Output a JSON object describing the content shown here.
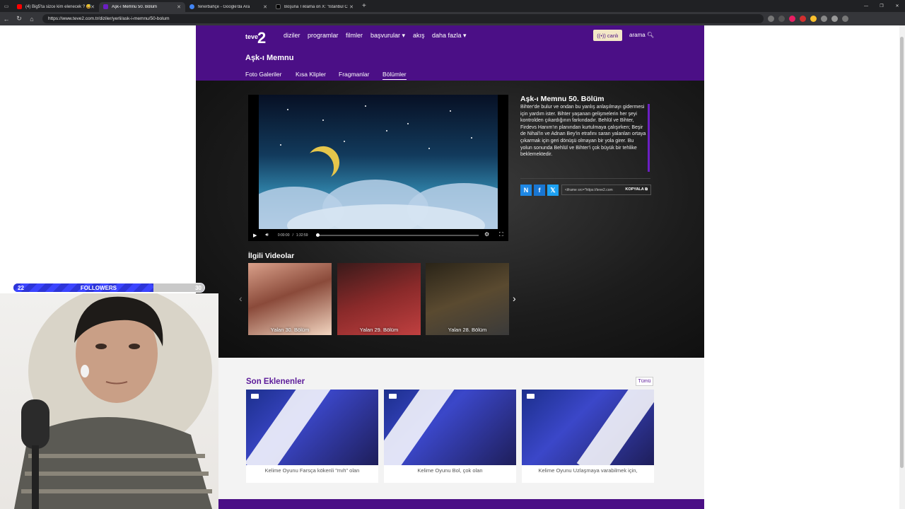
{
  "browser": {
    "tabs": [
      {
        "title": "(4) Big5'ta sizce kim elenecek ? 😅",
        "color": "#ff0000"
      },
      {
        "title": "Aşk-ı Memnu 50. Bölüm",
        "color": "#6b1fc3"
      },
      {
        "title": "fenerbahçe - Google'da Ara",
        "color": "#4285f4"
      },
      {
        "title": "Boşuna Tıklama on X: \"İstanbul C",
        "color": "#000000"
      }
    ],
    "new_tab": "+",
    "url": "https://www.teve2.com.tr/diziler/yerli/ask-i-memnu/50-bolum"
  },
  "site": {
    "logo": "teve2",
    "nav": [
      "diziler",
      "programlar",
      "filmler",
      "başvurular ▾",
      "akış",
      "daha fazla ▾"
    ],
    "live": "((•)) canlı",
    "search": "arama",
    "show_title": "Aşk-ı Memnu",
    "subtabs": [
      "Foto Galeriler",
      "Kısa Klipler",
      "Fragmanlar",
      "Bölümler"
    ],
    "active_subtab": "Bölümler",
    "player": {
      "current_time": "0:00:00",
      "separator": "/",
      "duration": "1:32:59",
      "progress": 0.0
    },
    "episode_title": "Aşk-ı Memnu 50. Bölüm",
    "episode_desc": "Bihter'de bulur ve ondan bu yanlış anlaşılmayı gidermesi için yardım ister. Bihter yaşanan gelişmelerin her şeyi kontrolden çıkardığının farkındadır. Behlül ve Bihter, Firdevs Hanım'ın planından kurtulmaya çalışırken; Beşir de Nihal'in ve Adnan Bey'in etrafını saran yalanları ortaya çıkarmak için geri dönüşü olmayan bir yola girer. Bu yolun sonunda Behlül ve Bihter'i çok büyük bir tehlike beklemektedir.",
    "share": {
      "n": "N",
      "facebook": "f",
      "x": "𝕏"
    },
    "embed_code": "<iframe src=\"https://teve2.com",
    "copy_label": "KOPYALA ⧉",
    "related_heading": "İlgili Videolar",
    "related": [
      "Yalan 30. Bölüm",
      "Yalan 29. Bölüm",
      "Yalan 28. Bölüm"
    ],
    "prev_arrow": "‹",
    "next_arrow": "›",
    "recent_heading": "Son Eklenenler",
    "all_label": "Tümü",
    "recent": [
      "Kelime Oyunu Farsça kökenli \"mıh\" olan",
      "Kelime Oyunu Bol, çok olan",
      "Kelime Oyunu Uzlaşmaya varabilmek için,"
    ]
  },
  "stream": {
    "followers_current": "22",
    "followers_label": "FOLLOWERS",
    "followers_goal": "30",
    "followers_progress": 0.733
  },
  "colors": {
    "brand_purple": "#4b0f86",
    "accent_purple": "#6b1fc3",
    "live_bg": "#f3e7c7"
  }
}
